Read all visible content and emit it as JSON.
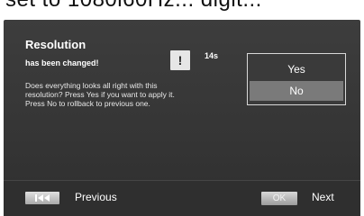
{
  "top_fragment": "set to 1080i60Hz... digit...",
  "dialog": {
    "title": "Resolution",
    "subtitle": "has been changed!",
    "warning_symbol": "!",
    "countdown": "14s",
    "message_lines": [
      "Does everything looks all right with this",
      "resolution? Press Yes if you want to apply it.",
      "Press No to rollback to previous one."
    ],
    "options": [
      {
        "label": "Yes",
        "selected": false
      },
      {
        "label": "No",
        "selected": true
      }
    ]
  },
  "footer": {
    "previous_label": "Previous",
    "ok_label": "OK",
    "next_label": "Next"
  },
  "icons": {
    "warning": "warning-icon",
    "previous": "skip-back-icon"
  },
  "colors": {
    "panel_bg": "#373737",
    "selected_option_bg": "#7a7a7a",
    "text": "#ffffff"
  }
}
